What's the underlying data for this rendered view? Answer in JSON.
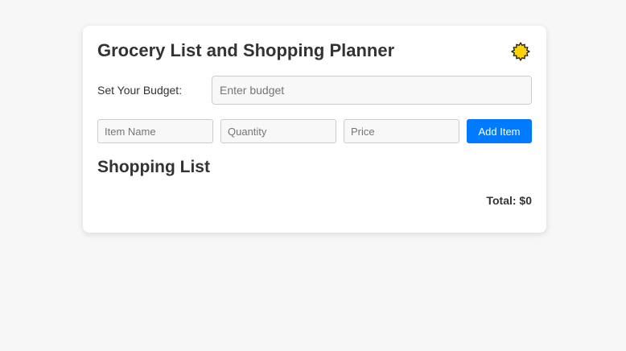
{
  "app": {
    "title": "Grocery List and Shopping Planner",
    "theme_icon": "sun-icon",
    "accent_color": "#007bff",
    "sun_color": "#ffd400"
  },
  "budget": {
    "label": "Set Your Budget:",
    "value": "",
    "placeholder": "Enter budget"
  },
  "item_form": {
    "name_placeholder": "Item Name",
    "quantity_placeholder": "Quantity",
    "price_placeholder": "Price",
    "add_label": "Add Item"
  },
  "list": {
    "heading": "Shopping List",
    "items": []
  },
  "total": {
    "text": "Total: $0"
  }
}
